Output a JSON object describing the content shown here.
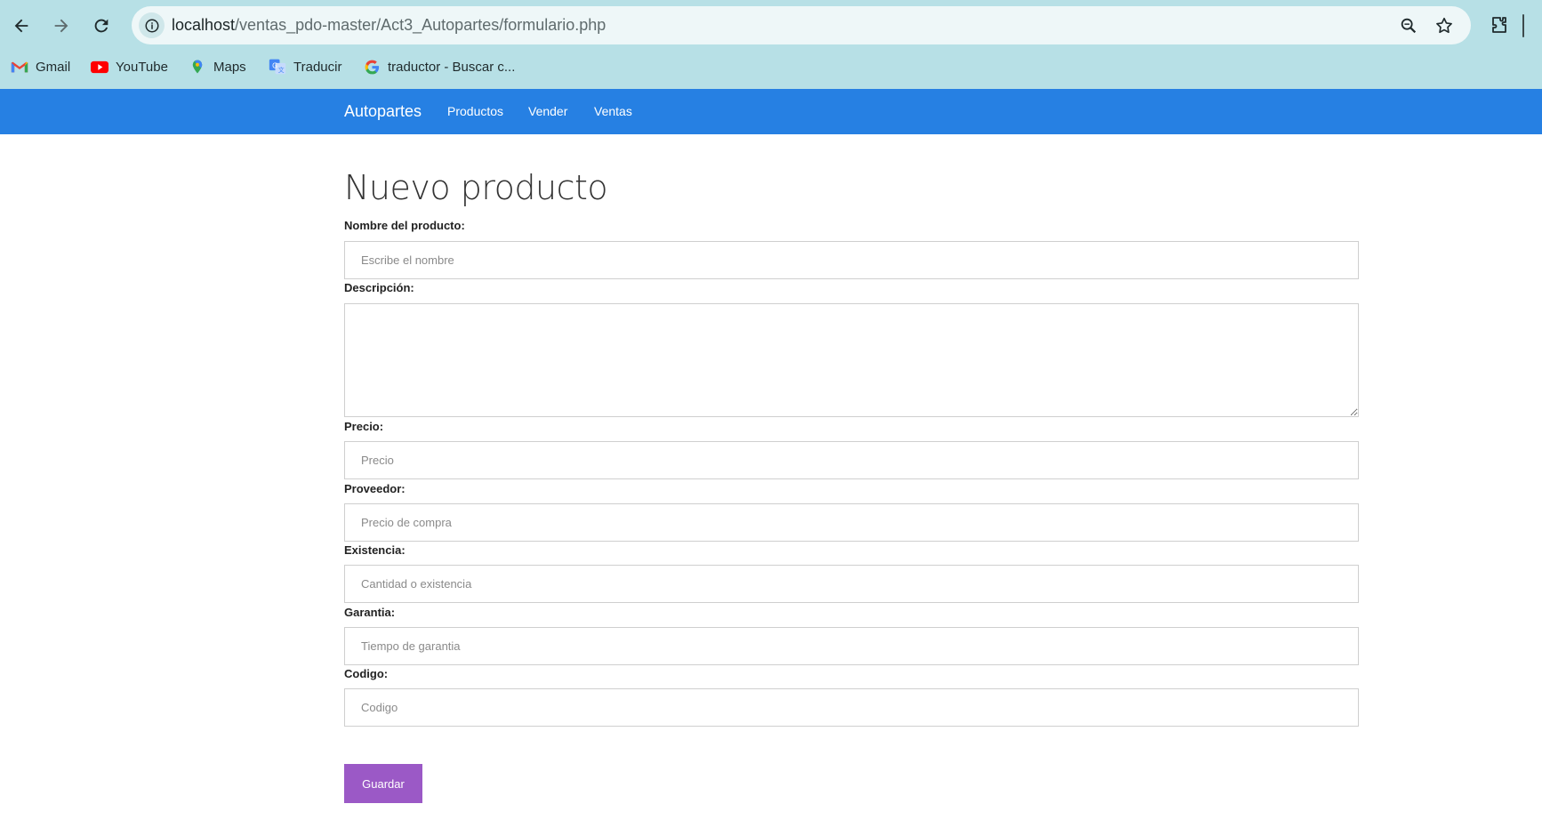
{
  "browser": {
    "url_host": "localhost",
    "url_path": "/ventas_pdo-master/Act3_Autopartes/formulario.php",
    "bookmarks": [
      {
        "label": "Gmail",
        "icon": "gmail-icon"
      },
      {
        "label": "YouTube",
        "icon": "youtube-icon"
      },
      {
        "label": "Maps",
        "icon": "maps-icon"
      },
      {
        "label": "Traducir",
        "icon": "translate-icon"
      },
      {
        "label": "traductor - Buscar c...",
        "icon": "google-icon"
      }
    ]
  },
  "navbar": {
    "brand": "Autopartes",
    "links": [
      "Productos",
      "Vender",
      "Ventas"
    ],
    "color": "#2680e3"
  },
  "form": {
    "title": "Nuevo producto",
    "fields": {
      "nombre": {
        "label": "Nombre del producto:",
        "placeholder": "Escribe el nombre"
      },
      "descripcion": {
        "label": "Descripción:"
      },
      "precio": {
        "label": "Precio:",
        "placeholder": "Precio"
      },
      "proveedor": {
        "label": "Proveedor:",
        "placeholder": "Precio de compra"
      },
      "existencia": {
        "label": "Existencia:",
        "placeholder": "Cantidad o existencia"
      },
      "garantia": {
        "label": "Garantia:",
        "placeholder": "Tiempo de garantia"
      },
      "codigo": {
        "label": "Codigo:",
        "placeholder": "Codigo"
      }
    },
    "submit_label": "Guardar",
    "submit_color": "#9b59c6"
  }
}
